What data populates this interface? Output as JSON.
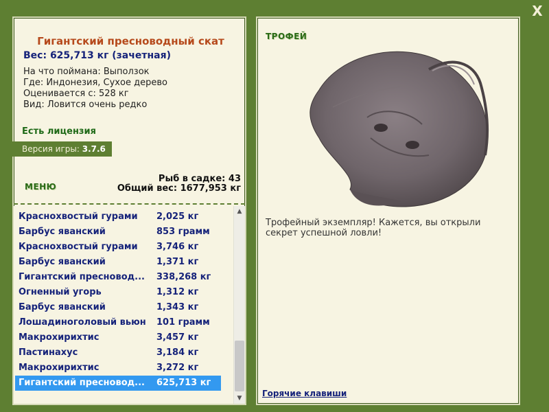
{
  "close_label": "X",
  "fish": {
    "name": "Гигантский пресноводный скат",
    "weight": "Вес: 625,713 кг (зачетная)",
    "details": [
      "На что поймана: Выползок",
      "Где: Индонезия, Сухое дерево",
      "Оценивается с: 528 кг",
      "Вид: Ловится очень редко"
    ]
  },
  "license": "Есть лицензия",
  "version": {
    "label": "Версия игры:",
    "value": "3.7.6"
  },
  "menu_label": "МЕНЮ",
  "keepnet": {
    "count": "Рыб в садке: 43",
    "total_weight": "Общий вес: 1677,953 кг"
  },
  "catch_list": [
    {
      "name": "Краснохвостый гурами",
      "weight": "2,025 кг"
    },
    {
      "name": "Барбус яванский",
      "weight": "853 грамм"
    },
    {
      "name": "Краснохвостый гурами",
      "weight": "3,746 кг"
    },
    {
      "name": "Барбус яванский",
      "weight": "1,371 кг"
    },
    {
      "name": "Гигантский пресновод...",
      "weight": "338,268 кг"
    },
    {
      "name": "Огненный угорь",
      "weight": "1,312 кг"
    },
    {
      "name": "Барбус яванский",
      "weight": "1,343 кг"
    },
    {
      "name": "Лошадиноголовый вьюн",
      "weight": "101 грамм"
    },
    {
      "name": "Макрохирихтис",
      "weight": "3,457 кг"
    },
    {
      "name": "Пастинахус",
      "weight": "3,184 кг"
    },
    {
      "name": "Макрохирихтис",
      "weight": "3,272 кг"
    },
    {
      "name": "Гигантский пресновод...",
      "weight": "625,713 кг",
      "selected": true
    }
  ],
  "trophy": {
    "label": "ТРОФЕЙ",
    "message": "Трофейный экземпляр! Кажется, вы открыли секрет успешной ловли!"
  },
  "hotkeys_label": "Горячие клавиши",
  "colors": {
    "frame": "#5e7f32",
    "panel": "#f7f4e2",
    "title": "#b64a1c",
    "link": "#16237a",
    "selection": "#3399f0",
    "license": "#1f6a18"
  }
}
